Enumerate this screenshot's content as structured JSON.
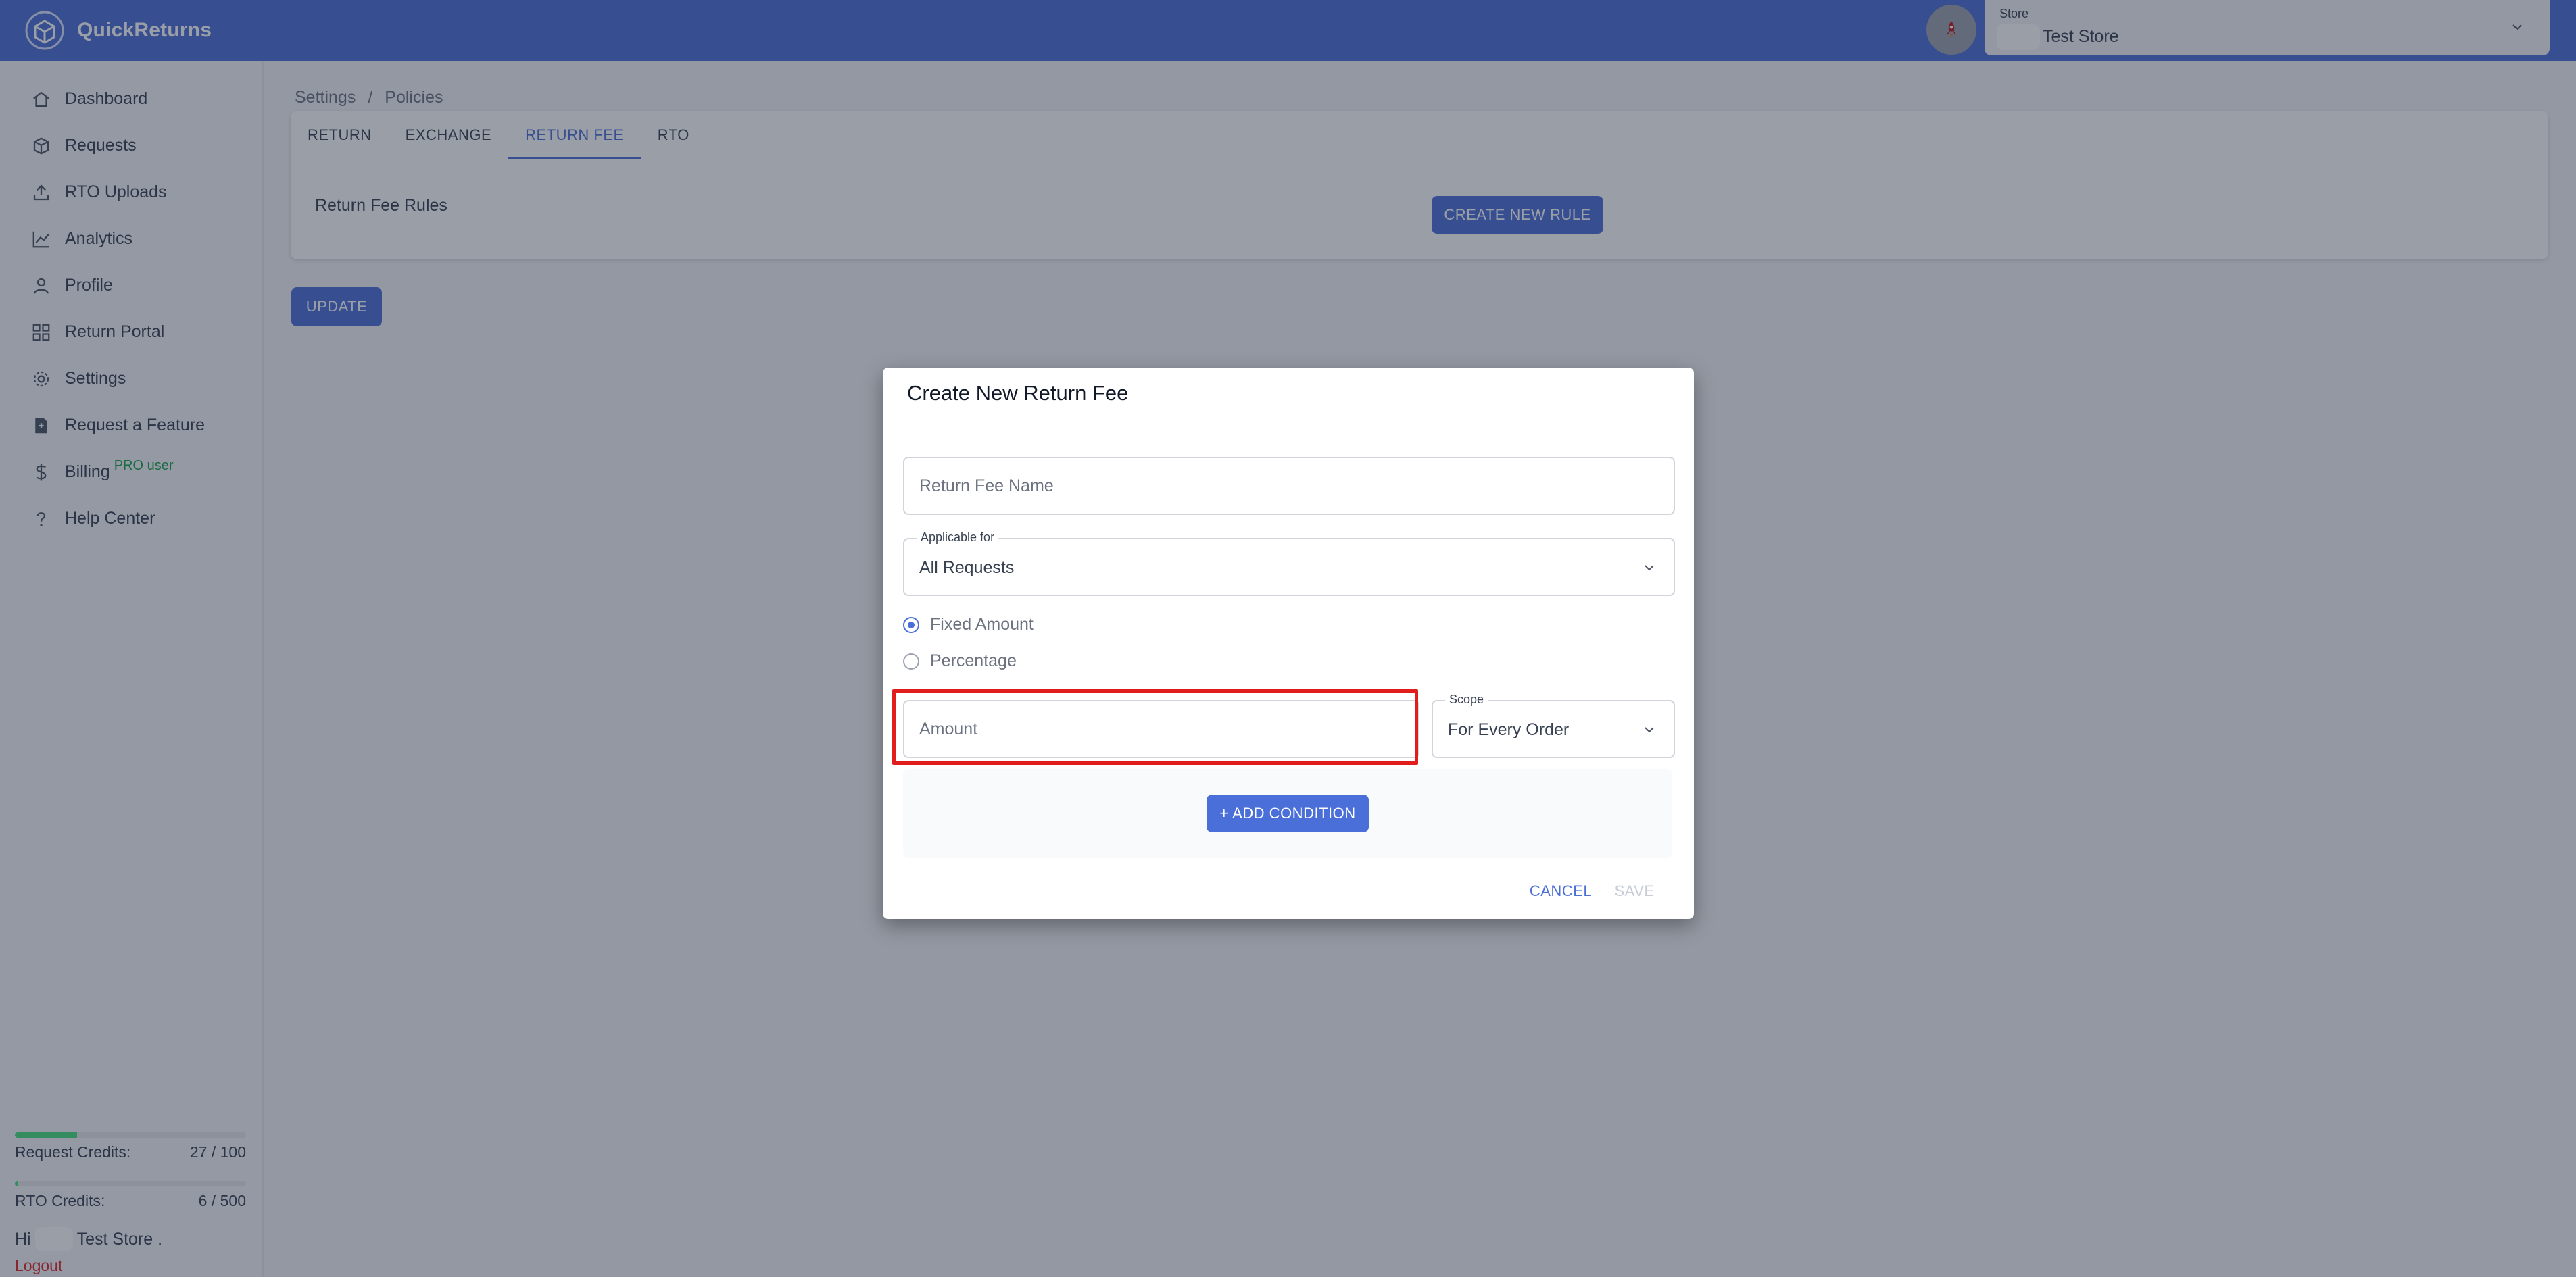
{
  "app": {
    "name": "QuickReturns"
  },
  "header": {
    "store_label": "Store",
    "store_value": "Test Store",
    "notification_icon": "rocket-icon"
  },
  "sidebar": {
    "items": [
      {
        "label": "Dashboard",
        "icon": "home-icon"
      },
      {
        "label": "Requests",
        "icon": "box-icon"
      },
      {
        "label": "RTO Uploads",
        "icon": "upload-icon"
      },
      {
        "label": "Analytics",
        "icon": "chart-line-icon"
      },
      {
        "label": "Profile",
        "icon": "user-icon"
      },
      {
        "label": "Return Portal",
        "icon": "grid-icon"
      },
      {
        "label": "Settings",
        "icon": "gear-icon"
      },
      {
        "label": "Request a Feature",
        "icon": "feature-icon"
      },
      {
        "label": "Billing",
        "icon": "dollar-icon",
        "badge": "PRO user"
      },
      {
        "label": "Help Center",
        "icon": "question-icon"
      }
    ],
    "credits": [
      {
        "label": "Request Credits:",
        "value": "27 / 100",
        "used": 27,
        "total": 100
      },
      {
        "label": "RTO Credits:",
        "value": "6 / 500",
        "used": 6,
        "total": 500
      }
    ],
    "greeting_prefix": "Hi",
    "greeting_name": "Test Store .",
    "logout": "Logout"
  },
  "main": {
    "breadcrumb": [
      "Settings",
      "/",
      "Policies"
    ],
    "tabs": [
      {
        "label": "RETURN",
        "active": false
      },
      {
        "label": "EXCHANGE",
        "active": false
      },
      {
        "label": "RETURN FEE",
        "active": true
      },
      {
        "label": "RTO",
        "active": false
      }
    ],
    "rules_label": "Return Fee Rules",
    "create_rule_button": "CREATE NEW RULE",
    "update_button": "UPDATE"
  },
  "modal": {
    "title": "Create New Return Fee",
    "fee_name_placeholder": "Return Fee Name",
    "applicable_label": "Applicable for",
    "applicable_value": "All Requests",
    "radio_options": [
      {
        "label": "Fixed Amount",
        "selected": true
      },
      {
        "label": "Percentage",
        "selected": false
      }
    ],
    "amount_placeholder": "Amount",
    "scope_label": "Scope",
    "scope_value": "For Every Order",
    "add_condition_button": "+ ADD CONDITION",
    "cancel_button": "CANCEL",
    "save_button": "SAVE"
  },
  "colors": {
    "primary": "#4b6fd8",
    "highlight": "#e11d1d",
    "credit_bar": "#4ade80",
    "pro_badge": "#16a34a",
    "logout": "#dc2626"
  }
}
